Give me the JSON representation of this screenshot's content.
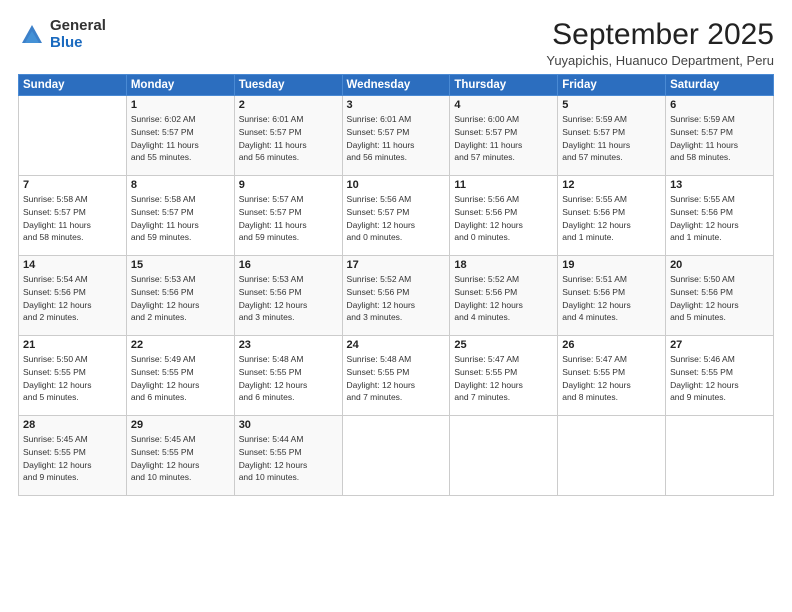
{
  "logo": {
    "general": "General",
    "blue": "Blue"
  },
  "title": "September 2025",
  "subtitle": "Yuyapichis, Huanuco Department, Peru",
  "days_header": [
    "Sunday",
    "Monday",
    "Tuesday",
    "Wednesday",
    "Thursday",
    "Friday",
    "Saturday"
  ],
  "weeks": [
    [
      {
        "day": "",
        "info": ""
      },
      {
        "day": "1",
        "info": "Sunrise: 6:02 AM\nSunset: 5:57 PM\nDaylight: 11 hours\nand 55 minutes."
      },
      {
        "day": "2",
        "info": "Sunrise: 6:01 AM\nSunset: 5:57 PM\nDaylight: 11 hours\nand 56 minutes."
      },
      {
        "day": "3",
        "info": "Sunrise: 6:01 AM\nSunset: 5:57 PM\nDaylight: 11 hours\nand 56 minutes."
      },
      {
        "day": "4",
        "info": "Sunrise: 6:00 AM\nSunset: 5:57 PM\nDaylight: 11 hours\nand 57 minutes."
      },
      {
        "day": "5",
        "info": "Sunrise: 5:59 AM\nSunset: 5:57 PM\nDaylight: 11 hours\nand 57 minutes."
      },
      {
        "day": "6",
        "info": "Sunrise: 5:59 AM\nSunset: 5:57 PM\nDaylight: 11 hours\nand 58 minutes."
      }
    ],
    [
      {
        "day": "7",
        "info": "Sunrise: 5:58 AM\nSunset: 5:57 PM\nDaylight: 11 hours\nand 58 minutes."
      },
      {
        "day": "8",
        "info": "Sunrise: 5:58 AM\nSunset: 5:57 PM\nDaylight: 11 hours\nand 59 minutes."
      },
      {
        "day": "9",
        "info": "Sunrise: 5:57 AM\nSunset: 5:57 PM\nDaylight: 11 hours\nand 59 minutes."
      },
      {
        "day": "10",
        "info": "Sunrise: 5:56 AM\nSunset: 5:57 PM\nDaylight: 12 hours\nand 0 minutes."
      },
      {
        "day": "11",
        "info": "Sunrise: 5:56 AM\nSunset: 5:56 PM\nDaylight: 12 hours\nand 0 minutes."
      },
      {
        "day": "12",
        "info": "Sunrise: 5:55 AM\nSunset: 5:56 PM\nDaylight: 12 hours\nand 1 minute."
      },
      {
        "day": "13",
        "info": "Sunrise: 5:55 AM\nSunset: 5:56 PM\nDaylight: 12 hours\nand 1 minute."
      }
    ],
    [
      {
        "day": "14",
        "info": "Sunrise: 5:54 AM\nSunset: 5:56 PM\nDaylight: 12 hours\nand 2 minutes."
      },
      {
        "day": "15",
        "info": "Sunrise: 5:53 AM\nSunset: 5:56 PM\nDaylight: 12 hours\nand 2 minutes."
      },
      {
        "day": "16",
        "info": "Sunrise: 5:53 AM\nSunset: 5:56 PM\nDaylight: 12 hours\nand 3 minutes."
      },
      {
        "day": "17",
        "info": "Sunrise: 5:52 AM\nSunset: 5:56 PM\nDaylight: 12 hours\nand 3 minutes."
      },
      {
        "day": "18",
        "info": "Sunrise: 5:52 AM\nSunset: 5:56 PM\nDaylight: 12 hours\nand 4 minutes."
      },
      {
        "day": "19",
        "info": "Sunrise: 5:51 AM\nSunset: 5:56 PM\nDaylight: 12 hours\nand 4 minutes."
      },
      {
        "day": "20",
        "info": "Sunrise: 5:50 AM\nSunset: 5:56 PM\nDaylight: 12 hours\nand 5 minutes."
      }
    ],
    [
      {
        "day": "21",
        "info": "Sunrise: 5:50 AM\nSunset: 5:55 PM\nDaylight: 12 hours\nand 5 minutes."
      },
      {
        "day": "22",
        "info": "Sunrise: 5:49 AM\nSunset: 5:55 PM\nDaylight: 12 hours\nand 6 minutes."
      },
      {
        "day": "23",
        "info": "Sunrise: 5:48 AM\nSunset: 5:55 PM\nDaylight: 12 hours\nand 6 minutes."
      },
      {
        "day": "24",
        "info": "Sunrise: 5:48 AM\nSunset: 5:55 PM\nDaylight: 12 hours\nand 7 minutes."
      },
      {
        "day": "25",
        "info": "Sunrise: 5:47 AM\nSunset: 5:55 PM\nDaylight: 12 hours\nand 7 minutes."
      },
      {
        "day": "26",
        "info": "Sunrise: 5:47 AM\nSunset: 5:55 PM\nDaylight: 12 hours\nand 8 minutes."
      },
      {
        "day": "27",
        "info": "Sunrise: 5:46 AM\nSunset: 5:55 PM\nDaylight: 12 hours\nand 9 minutes."
      }
    ],
    [
      {
        "day": "28",
        "info": "Sunrise: 5:45 AM\nSunset: 5:55 PM\nDaylight: 12 hours\nand 9 minutes."
      },
      {
        "day": "29",
        "info": "Sunrise: 5:45 AM\nSunset: 5:55 PM\nDaylight: 12 hours\nand 10 minutes."
      },
      {
        "day": "30",
        "info": "Sunrise: 5:44 AM\nSunset: 5:55 PM\nDaylight: 12 hours\nand 10 minutes."
      },
      {
        "day": "",
        "info": ""
      },
      {
        "day": "",
        "info": ""
      },
      {
        "day": "",
        "info": ""
      },
      {
        "day": "",
        "info": ""
      }
    ]
  ]
}
